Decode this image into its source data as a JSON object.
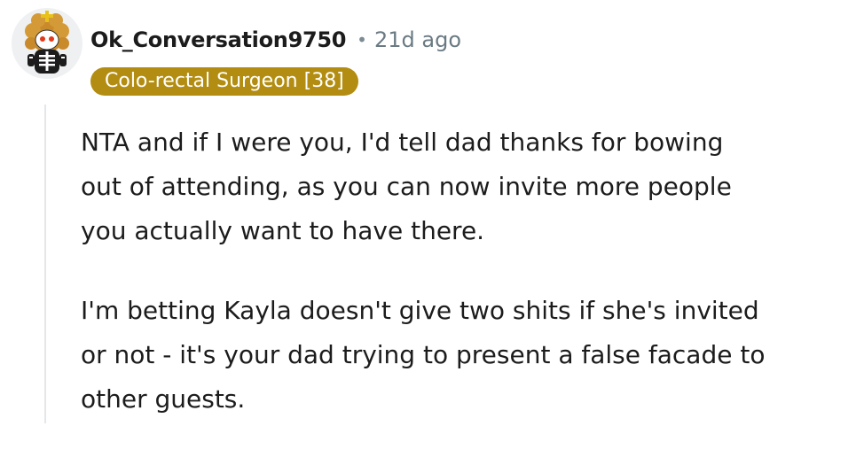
{
  "comment": {
    "username": "Ok_Conversation9750",
    "separator": "•",
    "age": "21d ago",
    "flair": "Colo-rectal Surgeon [38]",
    "paragraphs": [
      [
        "NTA and if I were you, I'd tell dad thanks for bowing",
        "out of attending, as you can now invite more people",
        "you actually want to have there."
      ],
      [
        "I'm betting Kayla doesn't give two shits if she's invited",
        "or not - it's your dad trying to present a false facade to",
        "other guests."
      ]
    ]
  },
  "avatar": {
    "icon": "snoo-avatar-skeleton-costume",
    "background": "#eef0f1"
  },
  "colors": {
    "flair_bg": "#b28d12",
    "flair_text": "#ffffff",
    "meta_text": "#6a7a83",
    "thread_line": "#e4e7e9"
  }
}
